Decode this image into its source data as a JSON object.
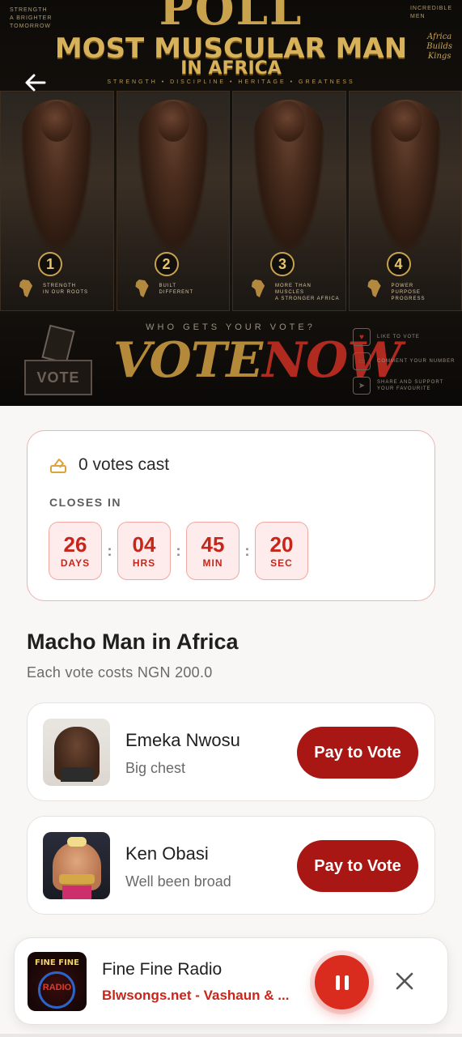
{
  "banner": {
    "topleft_text": "STRENGTH\nA BRIGHTER\nTOMORROW",
    "topright_text": "INCREDIBLE\nMEN",
    "poll_word": "POLL",
    "title_line1": "MOST MUSCULAR MAN",
    "title_line2": "IN AFRICA",
    "tagline": "STRENGTH • DISCIPLINE • HERITAGE • GREATNESS",
    "script_text": "Africa\nBuilds\nKings",
    "panels": [
      {
        "number": "1",
        "caption": "STRENGTH\nIN OUR ROOTS"
      },
      {
        "number": "2",
        "caption": "BUILT\nDIFFERENT"
      },
      {
        "number": "3",
        "caption": "MORE THAN\nMUSCLES\nA STRONGER AFRICA"
      },
      {
        "number": "4",
        "caption": "POWER\nPURPOSE\nPROGRESS"
      }
    ],
    "who_text": "WHO GETS YOUR VOTE?",
    "vote_now_part1": "VOTE",
    "vote_now_part2": "NOW",
    "ballot_box_label": "VOTE",
    "side_actions": [
      {
        "icon": "heart-icon",
        "text": "LIKE TO VOTE"
      },
      {
        "icon": "comment-icon",
        "text": "COMMENT YOUR NUMBER"
      },
      {
        "icon": "share-icon",
        "text": "SHARE AND SUPPORT\nYOUR FAVOURITE"
      }
    ]
  },
  "countdown": {
    "votes_text": "0 votes cast",
    "closes_label": "CLOSES IN",
    "units": [
      {
        "value": "26",
        "label": "DAYS"
      },
      {
        "value": "04",
        "label": "HRS"
      },
      {
        "value": "45",
        "label": "MIN"
      },
      {
        "value": "20",
        "label": "SEC"
      }
    ],
    "separator": ":"
  },
  "poll": {
    "title": "Macho Man in Africa",
    "subtitle": "Each vote costs NGN 200.0",
    "candidates": [
      {
        "name": "Emeka Nwosu",
        "description": "Big chest",
        "button_label": "Pay to Vote"
      },
      {
        "name": "Ken Obasi",
        "description": "Well been broad",
        "button_label": "Pay to Vote"
      }
    ]
  },
  "player": {
    "station": "Fine Fine Radio",
    "track": "Blwsongs.net - Vashaun & ...",
    "art_text_top": "FINE FINE",
    "art_text_mid": "RADIO"
  },
  "colors": {
    "accent_red": "#c8261a",
    "button_red": "#a81713",
    "gold": "#c9a24e"
  }
}
